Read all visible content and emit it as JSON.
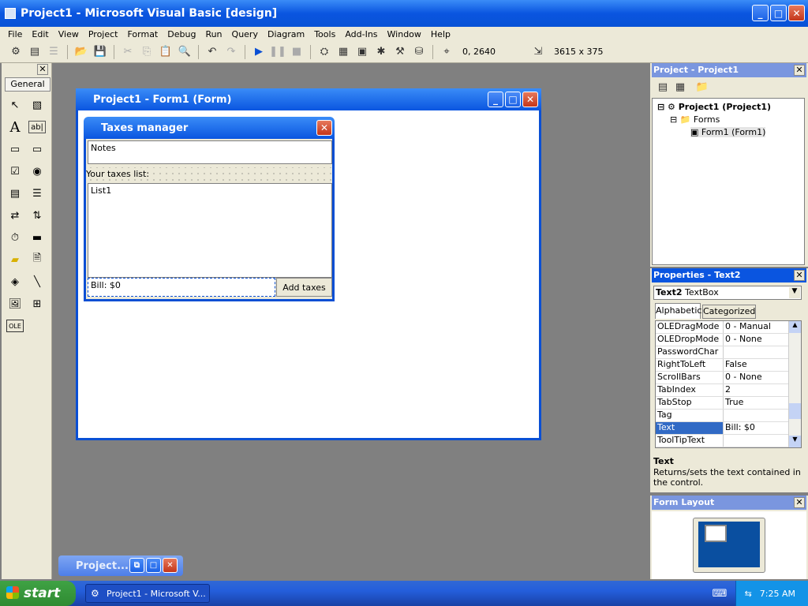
{
  "app": {
    "title": "Project1 - Microsoft Visual Basic [design]"
  },
  "menu": [
    "File",
    "Edit",
    "View",
    "Project",
    "Format",
    "Debug",
    "Run",
    "Query",
    "Diagram",
    "Tools",
    "Add-Ins",
    "Window",
    "Help"
  ],
  "toolbar": {
    "position": "0, 2640",
    "size": "3615 x 375"
  },
  "toolbox": {
    "tab_label": "General"
  },
  "mdi_form": {
    "title": "Project1 - Form1 (Form)"
  },
  "form": {
    "title": "Taxes manager",
    "notes_text": "Notes",
    "taxes_label": "Your taxes list:",
    "list_text": "List1",
    "bill_text": "Bill: $0",
    "add_button": "Add taxes"
  },
  "project": {
    "panel_title": "Project - Project1",
    "root": "Project1 (Project1)",
    "folder": "Forms",
    "form": "Form1 (Form1)"
  },
  "properties": {
    "panel_title": "Properties - Text2",
    "object_name": "Text2",
    "object_type": "TextBox",
    "tab_alpha": "Alphabetic",
    "tab_cat": "Categorized",
    "rows": [
      {
        "k": "OLEDragMode",
        "v": "0 - Manual"
      },
      {
        "k": "OLEDropMode",
        "v": "0 - None"
      },
      {
        "k": "PasswordChar",
        "v": ""
      },
      {
        "k": "RightToLeft",
        "v": "False"
      },
      {
        "k": "ScrollBars",
        "v": "0 - None"
      },
      {
        "k": "TabIndex",
        "v": "2"
      },
      {
        "k": "TabStop",
        "v": "True"
      },
      {
        "k": "Tag",
        "v": ""
      },
      {
        "k": "Text",
        "v": "Bill: $0"
      },
      {
        "k": "ToolTipText",
        "v": ""
      }
    ],
    "desc_title": "Text",
    "desc_text": "Returns/sets the text contained in the control."
  },
  "layout": {
    "panel_title": "Form Layout"
  },
  "minimized": {
    "title": "Project..."
  },
  "taskbar": {
    "start": "start",
    "item": "Project1 - Microsoft V...",
    "clock": "7:25 AM"
  }
}
